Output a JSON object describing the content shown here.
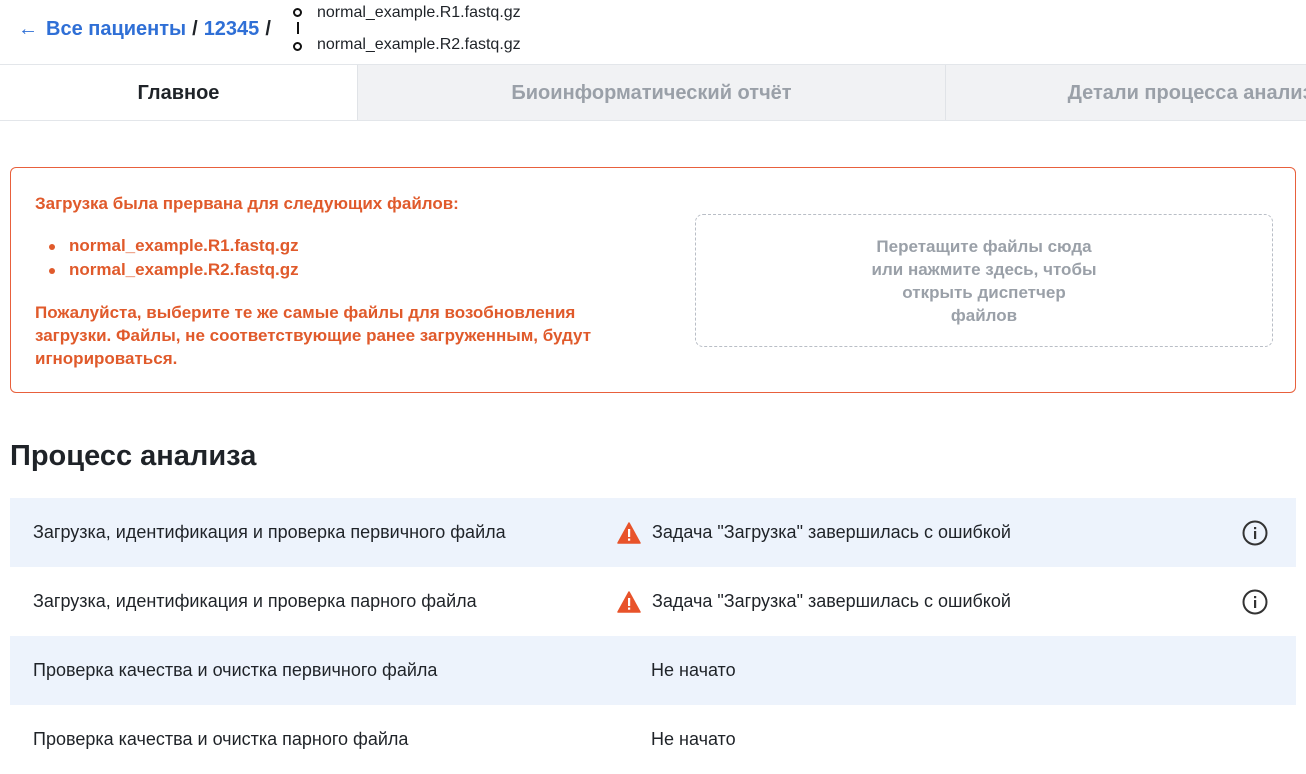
{
  "breadcrumb": {
    "back_label": "Все пациенты",
    "separator": "/",
    "patient_id": "12345"
  },
  "files": [
    "normal_example.R1.fastq.gz",
    "normal_example.R2.fastq.gz"
  ],
  "tabs": [
    {
      "label": "Главное",
      "active": true
    },
    {
      "label": "Биоинформатический отчёт",
      "active": false
    },
    {
      "label": "Детали процесса анализа",
      "active": false
    }
  ],
  "alert": {
    "title": "Загрузка была прервана для следующих файлов:",
    "files": [
      "normal_example.R1.fastq.gz",
      "normal_example.R2.fastq.gz"
    ],
    "message": "Пожалуйста, выберите те же самые файлы для возобновления загрузки. Файлы, не соответствующие ранее загруженным, будут игнорироваться.",
    "dropzone_text": "Перетащите файлы сюда или нажмите здесь, чтобы открыть диспетчер файлов"
  },
  "process": {
    "title": "Процесс анализа",
    "steps": [
      {
        "name": "Загрузка, идентификация и проверка первичного файла",
        "status": "Задача \"Загрузка\" завершилась с ошибкой",
        "icon": "warning-icon",
        "info": "info-icon"
      },
      {
        "name": "Загрузка, идентификация и проверка парного файла",
        "status": "Задача \"Загрузка\" завершилась с ошибкой",
        "icon": "warning-icon",
        "info": "info-icon"
      },
      {
        "name": "Проверка качества и очистка первичного файла",
        "status": "Не начато"
      },
      {
        "name": "Проверка качества и очистка парного файла",
        "status": "Не начато"
      }
    ]
  },
  "colors": {
    "link": "#2f6fd6",
    "error": "#e05a2b",
    "row_shade": "#edf3fc",
    "muted": "#9aa0a8"
  }
}
